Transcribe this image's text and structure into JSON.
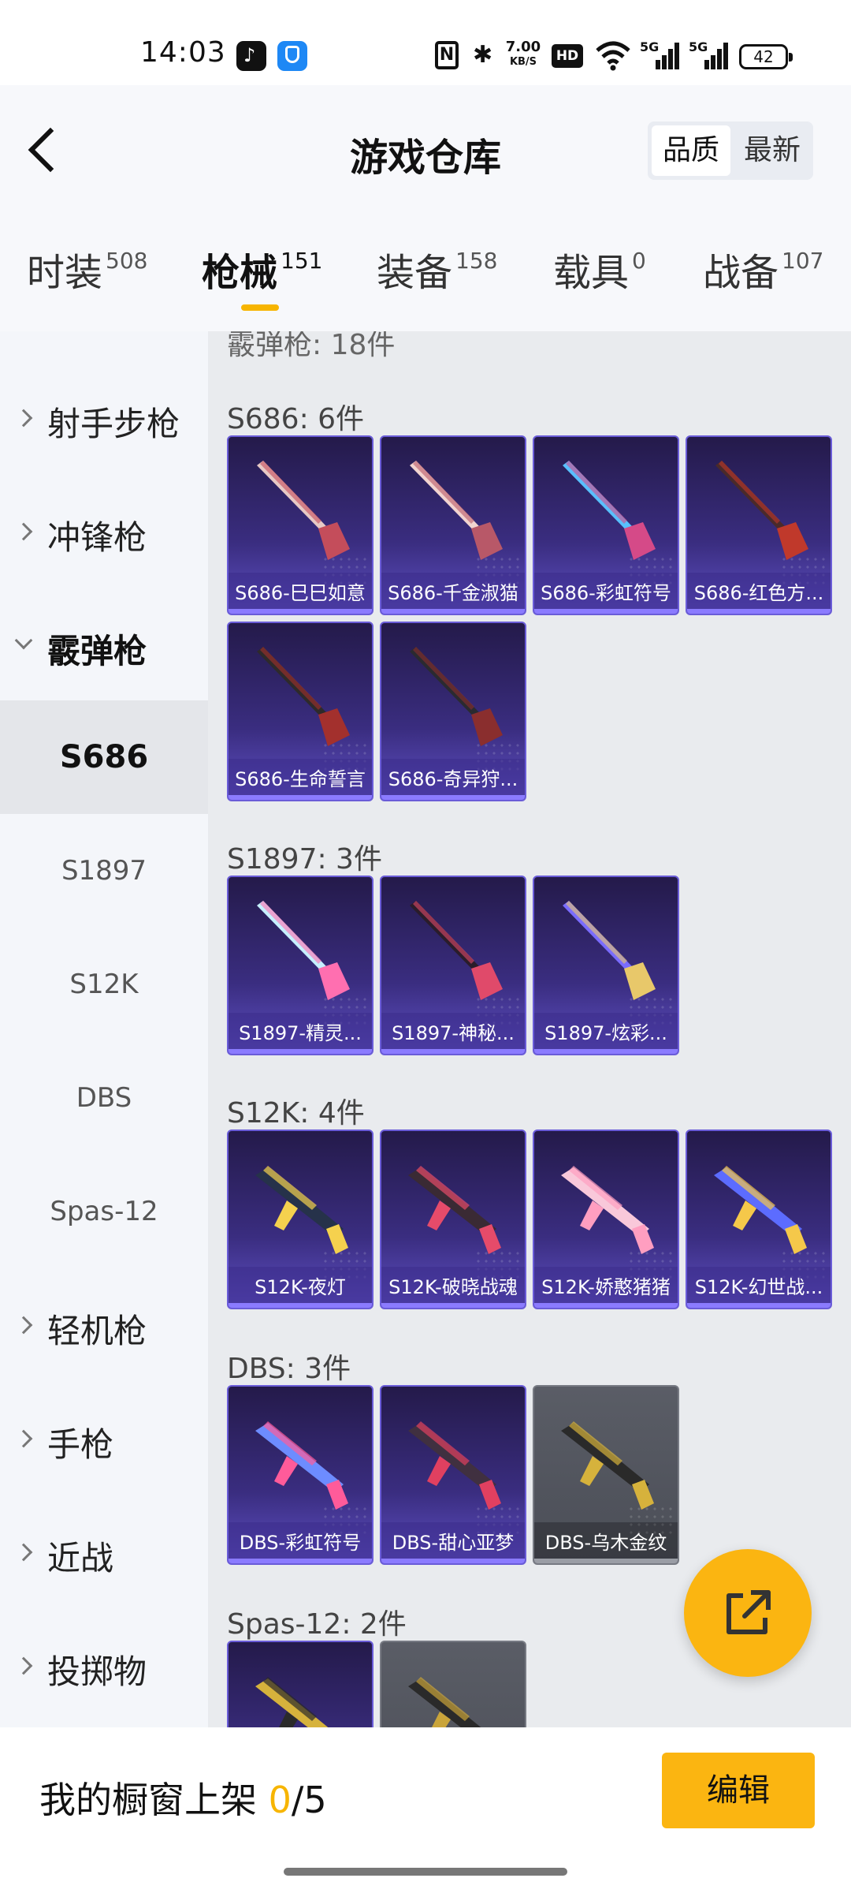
{
  "status_bar": {
    "time": "14:03",
    "net_speed": "7.00",
    "net_unit": "KB/S",
    "hd": "HD",
    "sig1": "5G",
    "sig2": "5G",
    "battery": "42"
  },
  "header": {
    "title": "游戏仓库",
    "sort_quality": "品质",
    "sort_latest": "最新"
  },
  "tabs": [
    {
      "label": "时装",
      "count": "508"
    },
    {
      "label": "枪械",
      "count": "151",
      "active": true
    },
    {
      "label": "装备",
      "count": "158"
    },
    {
      "label": "载具",
      "count": "0"
    },
    {
      "label": "战备",
      "count": "107"
    }
  ],
  "sidebar": {
    "categories": [
      {
        "label": "射手步枪"
      },
      {
        "label": "冲锋枪"
      },
      {
        "label": "霰弹枪",
        "expanded": true
      },
      {
        "label": "轻机枪"
      },
      {
        "label": "手枪"
      },
      {
        "label": "近战"
      },
      {
        "label": "投掷物"
      }
    ],
    "subitems": [
      "S686",
      "S1897",
      "S12K",
      "DBS",
      "Spas-12"
    ]
  },
  "content": {
    "cut_header": "霰弹枪: 18件",
    "sections": [
      {
        "title": "S686: 6件",
        "items": [
          "S686-巳巳如意",
          "S686-千金淑猫",
          "S686-彩虹符号",
          "S686-红色方...",
          "S686-生命誓言",
          "S686-奇异狩..."
        ]
      },
      {
        "title": "S1897: 3件",
        "items": [
          "S1897-精灵...",
          "S1897-神秘...",
          "S1897-炫彩..."
        ]
      },
      {
        "title": "S12K: 4件",
        "items": [
          "S12K-夜灯",
          "S12K-破晓战魂",
          "S12K-娇憨猪猪",
          "S12K-幻世战..."
        ]
      },
      {
        "title": "DBS: 3件",
        "items": [
          "DBS-彩虹符号",
          "DBS-甜心亚梦",
          "DBS-乌木金纹"
        ]
      },
      {
        "title": "Spas-12: 2件",
        "items": [
          "",
          ""
        ]
      }
    ]
  },
  "bottom": {
    "label": "我的橱窗上架 ",
    "count": "0",
    "sep_total": "/5",
    "edit": "编辑"
  },
  "colors": {
    "accent": "#fbb511",
    "card_purple": "#3a2d80",
    "card_gray": "#4b4e57"
  }
}
